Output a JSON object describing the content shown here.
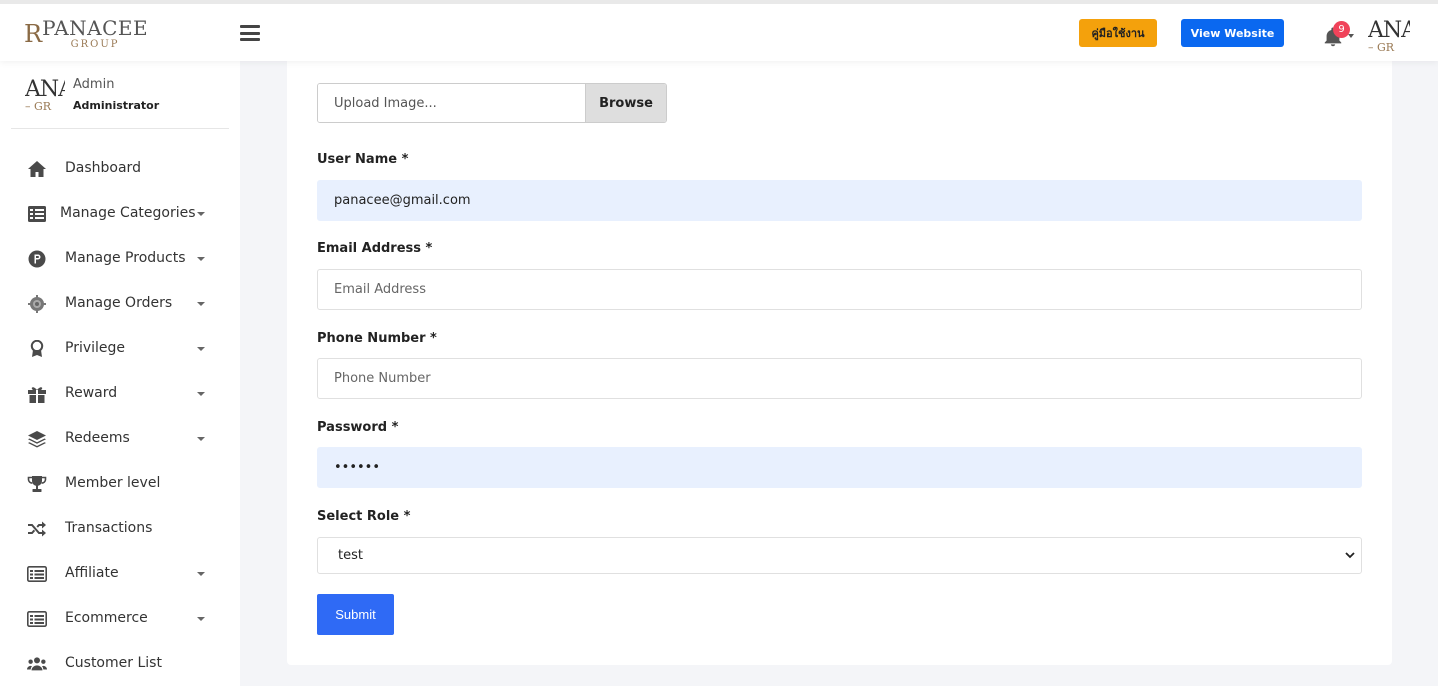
{
  "header": {
    "brand_mono": "R",
    "brand_name": "PANACEE",
    "brand_sub": "GROUP",
    "manual_button": "คู่มือใช้งาน",
    "view_website_button": "View Website",
    "notification_count": "9",
    "avatar_text_top": "ANA",
    "avatar_text_bottom": "– GR"
  },
  "sidebar": {
    "profile": {
      "avatar_text_top": "ANA",
      "avatar_text_bottom": "– GR",
      "name": "Admin",
      "role": "Administrator"
    },
    "items": [
      {
        "label": "Dashboard",
        "icon": "home-icon",
        "has_caret": false
      },
      {
        "label": "Manage Categories",
        "icon": "list-icon",
        "has_caret": true
      },
      {
        "label": "Manage Products",
        "icon": "product-p-icon",
        "has_caret": true
      },
      {
        "label": "Manage Orders",
        "icon": "orders-cog-icon",
        "has_caret": true
      },
      {
        "label": "Privilege",
        "icon": "award-icon",
        "has_caret": true
      },
      {
        "label": "Reward",
        "icon": "gift-icon",
        "has_caret": true
      },
      {
        "label": "Redeems",
        "icon": "layers-icon",
        "has_caret": true
      },
      {
        "label": "Member level",
        "icon": "trophy-icon",
        "has_caret": false
      },
      {
        "label": "Transactions",
        "icon": "shuffle-icon",
        "has_caret": false
      },
      {
        "label": "Affiliate",
        "icon": "table-list-icon",
        "has_caret": true
      },
      {
        "label": "Ecommerce",
        "icon": "table-list-icon",
        "has_caret": true
      },
      {
        "label": "Customer List",
        "icon": "users-icon",
        "has_caret": false
      }
    ]
  },
  "form": {
    "upload_placeholder": "Upload Image...",
    "browse_label": "Browse",
    "username_label": "User Name *",
    "username_value": "panacee@gmail.com",
    "email_label": "Email Address *",
    "email_placeholder": "Email Address",
    "phone_label": "Phone Number *",
    "phone_placeholder": "Phone Number",
    "password_label": "Password *",
    "password_value": "••••••",
    "role_label": "Select Role *",
    "role_value": "test",
    "submit_label": "Submit"
  },
  "colors": {
    "manual_button": "#f4a10c",
    "view_website_button": "#0a68f0",
    "submit_button": "#2f6af5",
    "autofill_field": "#e8f0fe",
    "badge": "#f0435a"
  }
}
